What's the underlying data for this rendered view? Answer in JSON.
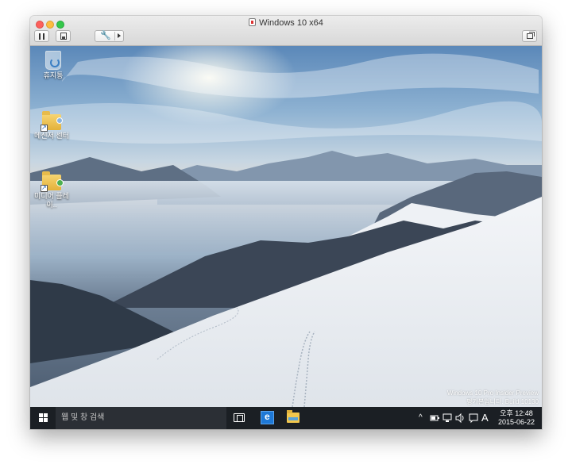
{
  "window": {
    "title": "Windows 10 x64"
  },
  "toolbar": {
    "pause_icon": "pause-icon",
    "snapshot_icon": "snapshot-icon",
    "tools_icon": "wrench-icon",
    "fullscreen_icon": "fullscreen-icon"
  },
  "desktop": {
    "icons": [
      {
        "label": "휴지통",
        "icon": "recycle-bin-icon"
      },
      {
        "label": "메신저 센터",
        "icon": "folder-shortcut-icon"
      },
      {
        "label": "미디어 플레이..",
        "icon": "folder-shortcut-icon"
      }
    ],
    "watermark": {
      "line1": "Windows 10 Pro Insider Preview",
      "line2": "평가본입니다. Build 10130"
    }
  },
  "taskbar": {
    "search_placeholder": "웹 및 창 검색",
    "apps": [
      "task-view-icon",
      "edge-icon",
      "file-explorer-icon"
    ],
    "tray": {
      "chevron": "^",
      "ime": "A"
    },
    "clock": {
      "time": "오후 12:48",
      "date": "2015-06-22"
    }
  },
  "colors": {
    "taskbar": "#1b1f24",
    "search_box": "#2b2f35",
    "edge_blue": "#1e78d6"
  }
}
